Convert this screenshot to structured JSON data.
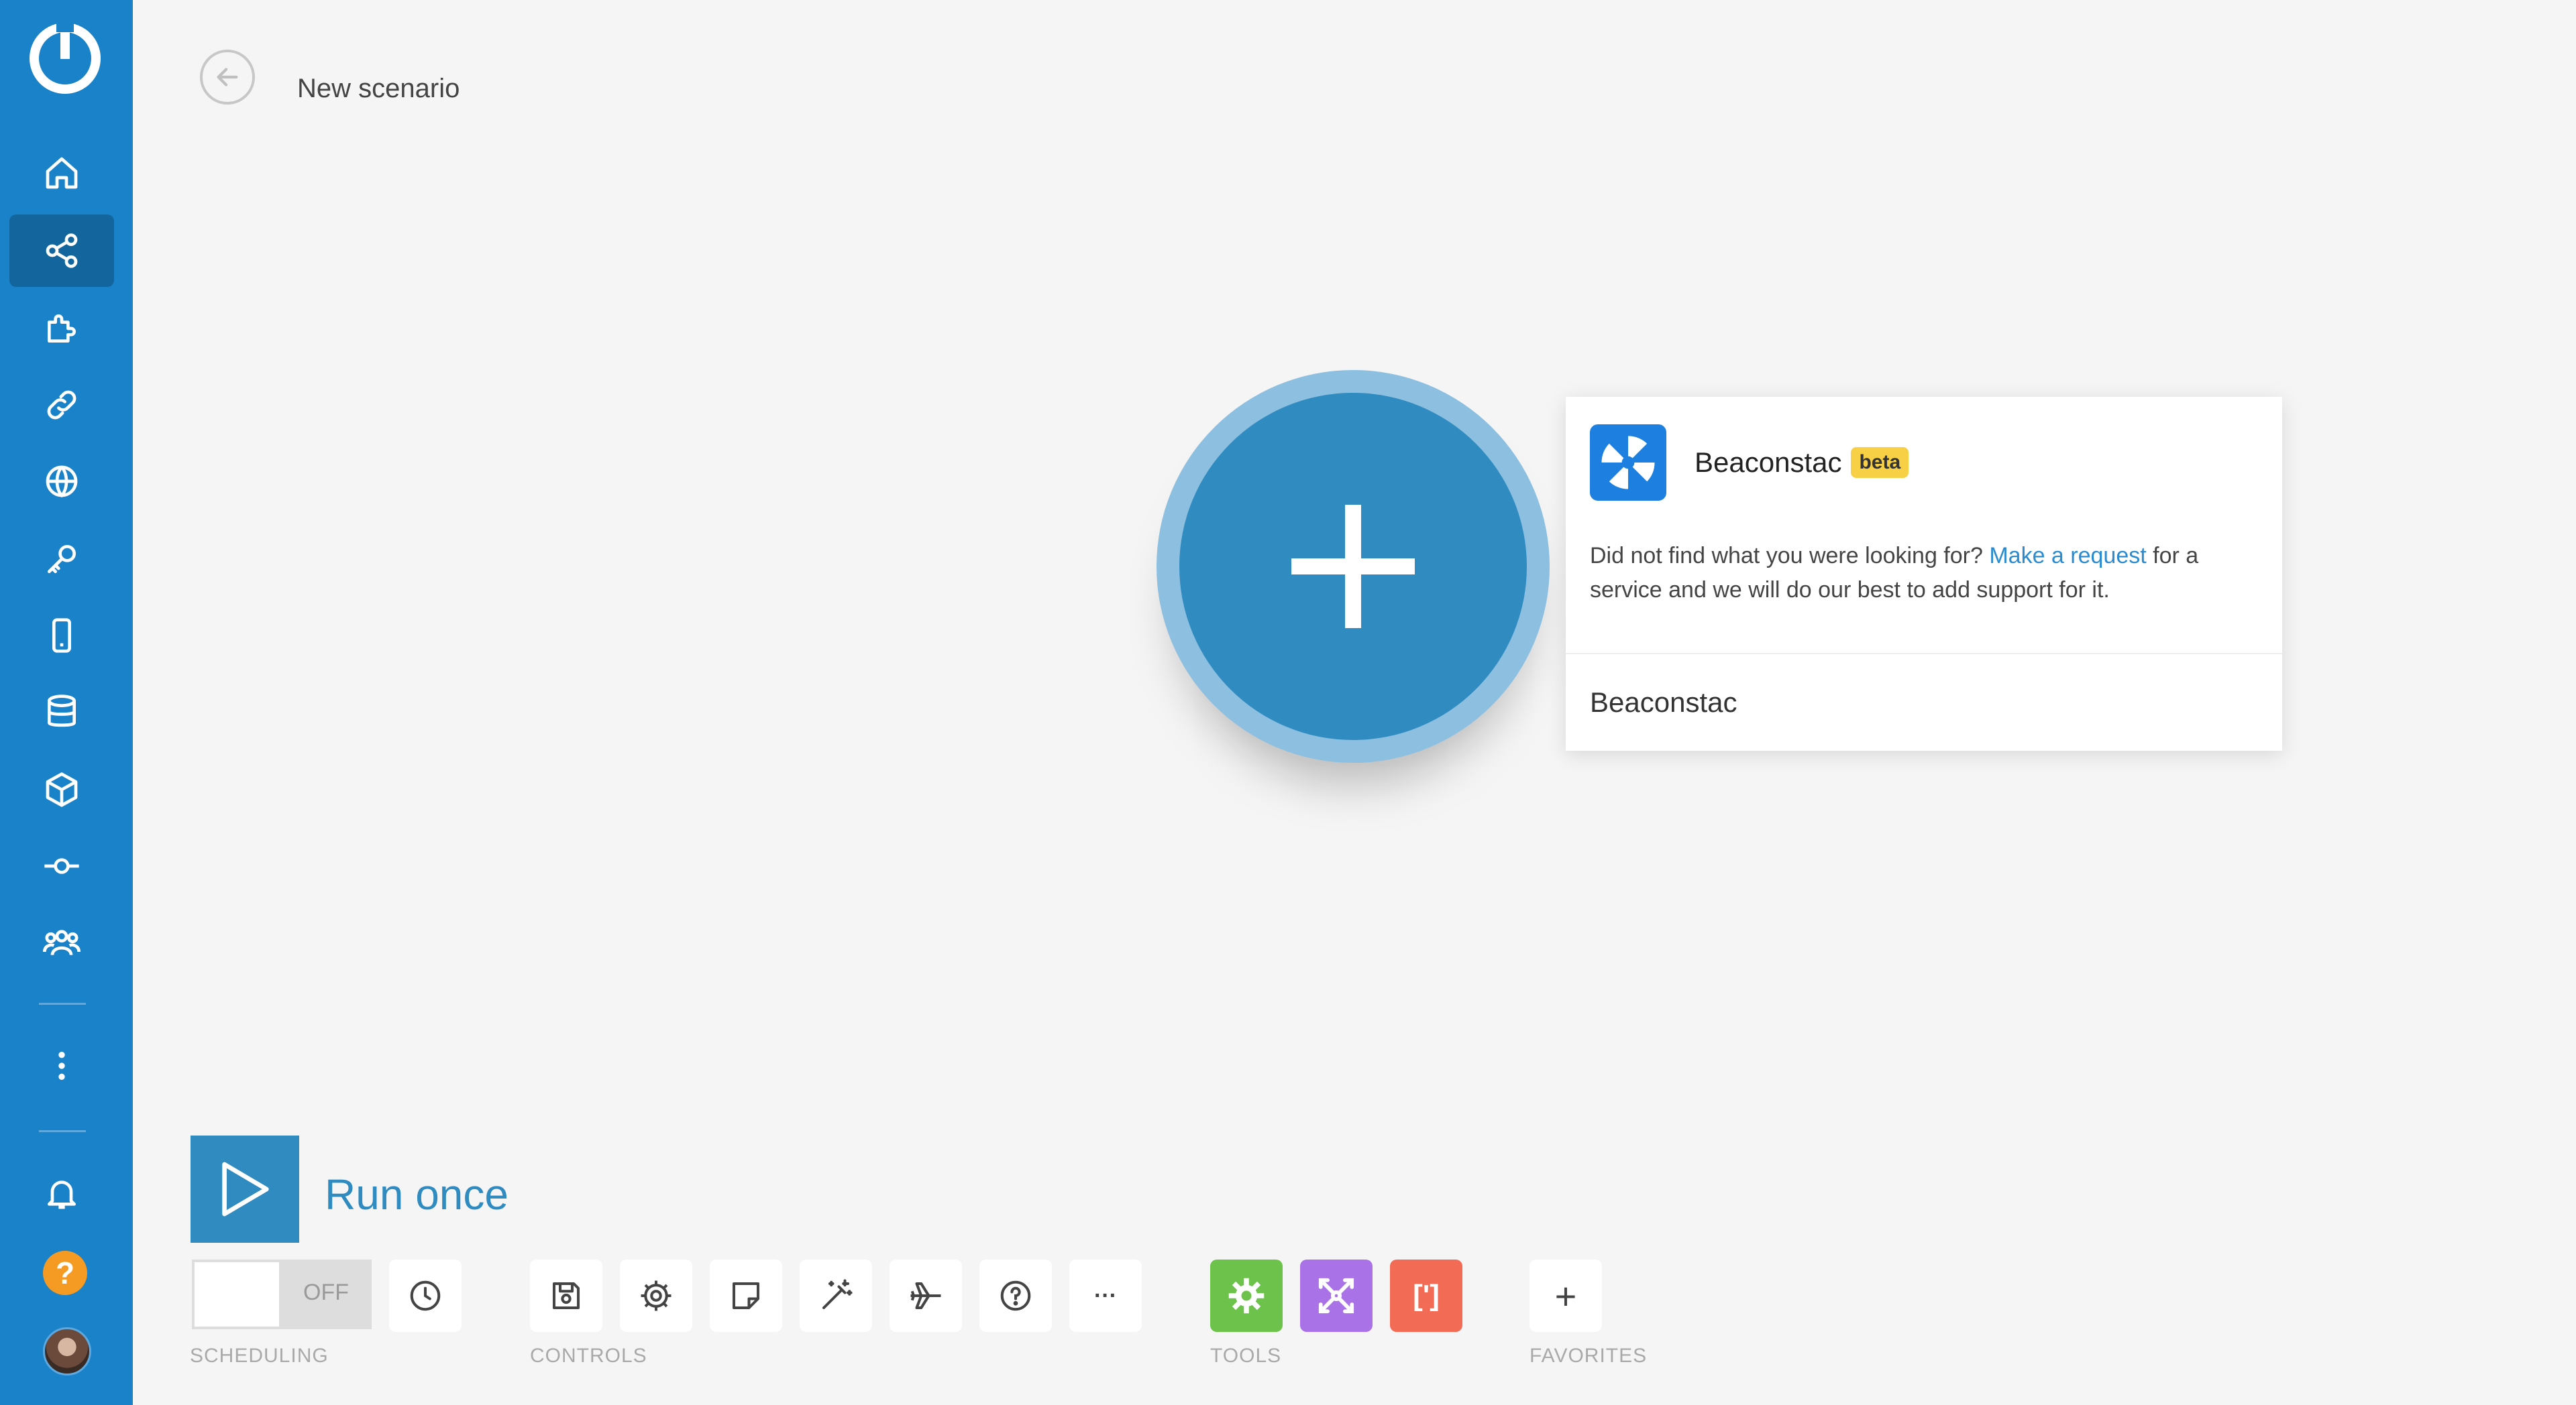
{
  "header": {
    "back_icon": "arrow-left-icon",
    "scenario_title": "New scenario"
  },
  "sidebar": {
    "items": [
      {
        "name": "home",
        "icon": "home-icon"
      },
      {
        "name": "scenarios",
        "icon": "share-icon",
        "active": true
      },
      {
        "name": "templates",
        "icon": "puzzle-icon"
      },
      {
        "name": "connections",
        "icon": "link-icon"
      },
      {
        "name": "webhooks",
        "icon": "globe-icon"
      },
      {
        "name": "keys",
        "icon": "key-icon"
      },
      {
        "name": "devices",
        "icon": "mobile-icon"
      },
      {
        "name": "data-stores",
        "icon": "database-icon"
      },
      {
        "name": "data-structures",
        "icon": "cube-icon"
      },
      {
        "name": "custom-apps",
        "icon": "commit-icon"
      },
      {
        "name": "team",
        "icon": "users-icon"
      }
    ],
    "more_icon": "more-vertical-icon",
    "notifications_icon": "bell-icon",
    "help_label": "?"
  },
  "popup": {
    "app_name": "Beaconstac",
    "badge": "beta",
    "message_before": "Did not find what you were looking for? ",
    "message_link": "Make a request",
    "message_after": " for a service and we will do our best to add support for it.",
    "search_value": "Beaconstac"
  },
  "run": {
    "label": "Run once"
  },
  "toolbar": {
    "scheduling": {
      "toggle_label": "OFF",
      "section_label": "SCHEDULING"
    },
    "controls": {
      "section_label": "CONTROLS",
      "buttons": [
        "save-icon",
        "gear-icon",
        "note-icon",
        "magic-wand-icon",
        "airplane-icon",
        "help-circle-icon",
        "ellipsis-icon"
      ],
      "more_label": "···"
    },
    "tools": {
      "section_label": "TOOLS",
      "buttons": [
        {
          "icon": "gear-icon",
          "color": "#6cc24a"
        },
        {
          "icon": "router-icon",
          "color": "#a972e6"
        },
        {
          "icon": "brackets-icon",
          "color": "#f26b54"
        }
      ],
      "bracket_label": "[']"
    },
    "favorites": {
      "section_label": "FAVORITES",
      "add_label": "+"
    }
  },
  "colors": {
    "sidebar": "#1a82c9",
    "accent": "#2f8bc0",
    "beta": "#f7d045",
    "link": "#2a8bd0"
  }
}
